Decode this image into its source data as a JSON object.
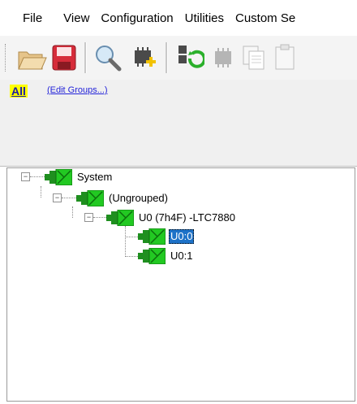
{
  "menu": {
    "items": [
      "File",
      "View",
      "Configuration",
      "Utilities",
      "Custom Se"
    ]
  },
  "toolbar": {
    "buttons": [
      {
        "name": "open-folder-icon"
      },
      {
        "name": "save-icon"
      },
      {
        "name": "search-icon"
      },
      {
        "name": "add-chip-icon"
      },
      {
        "name": "refresh-device-icon"
      },
      {
        "name": "chip-icon"
      },
      {
        "name": "copy-icon"
      },
      {
        "name": "paste-icon"
      }
    ]
  },
  "groups": {
    "all_label": "All",
    "edit_label": "(Edit Groups...)"
  },
  "tree": {
    "system": "System",
    "ungrouped": "(Ungrouped)",
    "device": "U0 (7h4F) -LTC7880",
    "page0": "U0:0",
    "page1": "U0:1"
  },
  "colors": {
    "node_green": "#22c922",
    "selection": "#1e72c8",
    "all_highlight": "#ffff00"
  }
}
